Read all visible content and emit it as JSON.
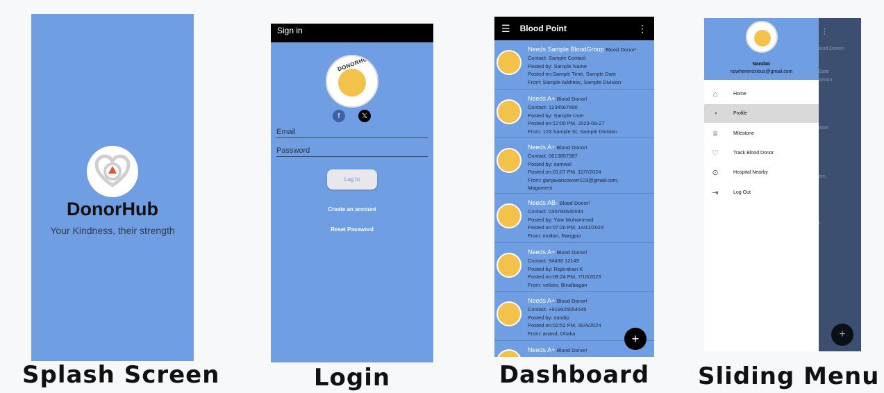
{
  "splash": {
    "app_name": "DonorHub",
    "tagline": "Your Kindness, their strength",
    "caption": "Splash Screen"
  },
  "login": {
    "title": "Sign in",
    "badge_text": "DONORHUB",
    "email_placeholder": "Email",
    "password_placeholder": "Password",
    "login_button": "Log In",
    "create_account": "Create an account",
    "reset_password": "Reset Password",
    "social_icons": [
      "facebook-icon",
      "x-icon"
    ],
    "caption": "Login"
  },
  "dashboard": {
    "title": "Blood Point",
    "caption": "Dashboard",
    "cards": [
      {
        "needs": "Needs Sample BloodGroup",
        "suffix": "Blood Donor!",
        "contact": "Contact: Sample Contact",
        "posted_by": "Posted by: Sample Name",
        "posted_on": "Posted on:Sample Time, Sample Date",
        "from": "From: Sample Address, Sample Division",
        "from2": ""
      },
      {
        "needs": "Needs A+",
        "suffix": "Blood Donor!",
        "contact": "Contact: 1234567890",
        "posted_by": "Posted by: Sample User",
        "posted_on": "Posted on:12:00 PM, 2023-09-27",
        "from": "From: 123 Sample St, Sample Division",
        "from2": ""
      },
      {
        "needs": "Needs A+",
        "suffix": "Blood Donor!",
        "contact": "Contact: 0613857387",
        "posted_by": "Posted by: samwel",
        "posted_on": "Posted on:01:07 PM, 12/7/2024",
        "from": "From: ganjavancouver103@gmail.com,",
        "from2": "Magomeni"
      },
      {
        "needs": "Needs AB-",
        "suffix": "Blood Donor!",
        "contact": "Contact: 030784640044",
        "posted_by": "Posted by: Yaar Muhammad",
        "posted_on": "Posted on:07:20 PM, 14/11/2023",
        "from": "From: multan, Rangpur",
        "from2": ""
      },
      {
        "needs": "Needs A+",
        "suffix": "Blood Donor!",
        "contact": "Contact: 94438 12149",
        "posted_by": "Posted by: Rajendran K",
        "posted_on": "Posted on:08:24 PM, 7/10/2023",
        "from": "From: vellore, Binalbagan",
        "from2": ""
      },
      {
        "needs": "Needs A+",
        "suffix": "Blood Donor!",
        "contact": "Contact: +919925554545",
        "posted_by": "Posted by: sandip",
        "posted_on": "Posted on:02:52 PM, 30/4/2024",
        "from": "From: anand, Dhaka",
        "from2": ""
      },
      {
        "needs": "Needs A+",
        "suffix": "Blood Donor!",
        "contact": "",
        "posted_by": "",
        "posted_on": "",
        "from": "",
        "from2": ""
      }
    ],
    "fab": "+"
  },
  "menu": {
    "caption": "Sliding Menu",
    "user_name": "Nandan",
    "user_email": "nowherenoxious@gmail.com",
    "items": [
      {
        "label": "Home",
        "icon": "home-icon",
        "glyph": "⌂"
      },
      {
        "label": "Profile",
        "icon": "profile-icon",
        "glyph": "◔"
      },
      {
        "label": "Milestone",
        "icon": "trophy-icon",
        "glyph": "♕"
      },
      {
        "label": "Track Blood Donor",
        "icon": "hand-heart-icon",
        "glyph": "♡"
      },
      {
        "label": "Hospital Nearby",
        "icon": "location-pin-icon",
        "glyph": "⊙"
      },
      {
        "label": "Log Out",
        "icon": "logout-icon",
        "glyph": "⇥"
      }
    ],
    "background_fragments": [
      "lood Donor!",
      "Date",
      "ivision",
      "ision",
      "om,",
      "r"
    ],
    "fab": "+"
  },
  "colors": {
    "primary": "#6f9ee3",
    "appbar": "#000000",
    "drop": "#e5533f"
  }
}
